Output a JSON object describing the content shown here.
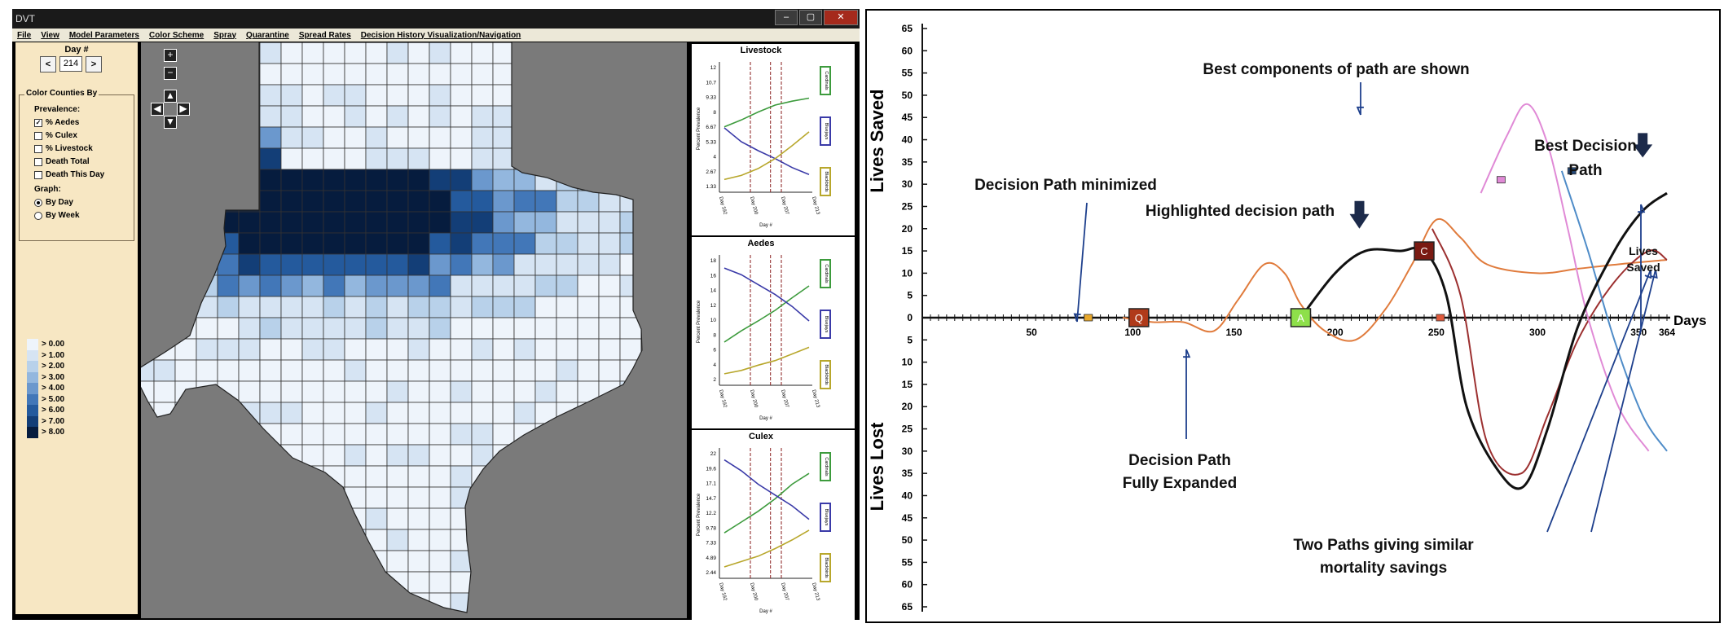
{
  "window": {
    "title": "DVT",
    "min": "–",
    "max": "▢",
    "close": "✕"
  },
  "menu": [
    "File",
    "View",
    "Model Parameters",
    "Color Scheme",
    "Spray",
    "Quarantine",
    "Spread Rates",
    "Decision History Visualization/Navigation"
  ],
  "sidebar": {
    "day_label": "Day #",
    "day_value": "214",
    "prev": "<",
    "next": ">",
    "group_title": "Color Counties By",
    "prevalence_label": "Prevalence:",
    "options": [
      {
        "label": "% Aedes",
        "checked": true
      },
      {
        "label": "% Culex",
        "checked": false
      },
      {
        "label": "% Livestock",
        "checked": false
      },
      {
        "label": "Death Total",
        "checked": false
      },
      {
        "label": "Death This Day",
        "checked": false
      }
    ],
    "graph_label": "Graph:",
    "graph_options": [
      {
        "label": "By Day",
        "selected": true
      },
      {
        "label": "By Week",
        "selected": false
      }
    ],
    "legend": [
      {
        "label": "> 0.00",
        "color": "#eef4fb"
      },
      {
        "label": "> 1.00",
        "color": "#d6e4f3"
      },
      {
        "label": "> 2.00",
        "color": "#b8d1ea"
      },
      {
        "label": "> 3.00",
        "color": "#93b7de"
      },
      {
        "label": "> 4.00",
        "color": "#6b98cd"
      },
      {
        "label": "> 5.00",
        "color": "#4277b8"
      },
      {
        "label": "> 6.00",
        "color": "#245a9d"
      },
      {
        "label": "> 7.00",
        "color": "#133e77"
      },
      {
        "label": "> 8.00",
        "color": "#061c3e"
      }
    ]
  },
  "map": {
    "zoom_in": "+",
    "zoom_out": "−",
    "pan": [
      "▲",
      "◀",
      "▶",
      "▼"
    ]
  },
  "mini_charts": [
    {
      "title": "Livestock",
      "y_ticks": [
        "12",
        "10.7",
        "9.33",
        "8",
        "6.67",
        "5.33",
        "4",
        "2.67",
        "1.33"
      ],
      "x_ticks": [
        "Day 192",
        "Day 200",
        "Day 207",
        "Day 213"
      ],
      "ylabel": "Percent Prevalence",
      "xlabel": "Day #",
      "legend": [
        "Cardinals",
        "Bluejays",
        "Blackbirds"
      ],
      "series": [
        {
          "color": "#3d9b3d",
          "values": [
            6.1,
            6.8,
            7.6,
            8.3,
            8.7,
            9.0
          ]
        },
        {
          "color": "#3a3aa8",
          "values": [
            6.0,
            4.6,
            3.7,
            2.9,
            2.0,
            1.3
          ]
        },
        {
          "color": "#b8a72c",
          "values": [
            0.8,
            1.2,
            1.9,
            2.9,
            4.2,
            5.6
          ]
        }
      ],
      "ylim": [
        0,
        12
      ]
    },
    {
      "title": "Aedes",
      "y_ticks": [
        "18",
        "16",
        "14",
        "12",
        "10",
        "8",
        "6",
        "4",
        "2"
      ],
      "x_ticks": [
        "Day 192",
        "Day 200",
        "Day 207",
        "Day 213"
      ],
      "ylabel": "Percent Prevalence",
      "xlabel": "Day #",
      "legend": [
        "Cardinals",
        "Bluejays",
        "Blackbirds"
      ],
      "series": [
        {
          "color": "#3d9b3d",
          "values": [
            5.8,
            7.5,
            9.0,
            10.6,
            12.5,
            14.3
          ]
        },
        {
          "color": "#3a3aa8",
          "values": [
            17.0,
            16.0,
            14.5,
            13.0,
            11.2,
            9.0
          ]
        },
        {
          "color": "#b8a72c",
          "values": [
            1.0,
            1.5,
            2.3,
            3.0,
            4.0,
            5.0
          ]
        }
      ],
      "ylim": [
        0,
        18
      ]
    },
    {
      "title": "Culex",
      "y_ticks": [
        "22",
        "19.6",
        "17.1",
        "14.7",
        "12.2",
        "9.78",
        "7.33",
        "4.89",
        "2.44"
      ],
      "x_ticks": [
        "Day 192",
        "Day 200",
        "Day 207",
        "Day 213"
      ],
      "ylabel": "Percent Prevalence",
      "xlabel": "Day #",
      "legend": [
        "Cardinals",
        "Bluejays",
        "Blackbirds"
      ],
      "series": [
        {
          "color": "#3d9b3d",
          "values": [
            7.5,
            9.5,
            11.5,
            13.8,
            16.5,
            18.5
          ]
        },
        {
          "color": "#3a3aa8",
          "values": [
            21.0,
            19.0,
            16.5,
            14.5,
            12.5,
            10.0
          ]
        },
        {
          "color": "#b8a72c",
          "values": [
            1.2,
            2.2,
            3.2,
            4.6,
            6.2,
            8.0
          ]
        }
      ],
      "ylim": [
        0,
        22
      ]
    }
  ],
  "decision_chart": {
    "y_labels": [
      "65",
      "60",
      "55",
      "50",
      "45",
      "40",
      "35",
      "30",
      "25",
      "20",
      "15",
      "10",
      "5",
      "0",
      "5",
      "10",
      "15",
      "20",
      "25",
      "30",
      "35",
      "40",
      "45",
      "50",
      "55",
      "60",
      "65"
    ],
    "x_labels": [
      "50",
      "100",
      "150",
      "200",
      "250",
      "300",
      "350",
      "364"
    ],
    "x_values": [
      50,
      100,
      150,
      200,
      250,
      300,
      350,
      364
    ],
    "xlim": [
      0,
      364
    ],
    "ylim": [
      -65,
      65
    ],
    "ylabel_top": "Lives Saved",
    "ylabel_bottom": "Lives Lost",
    "xlabel": "Days",
    "annotations": {
      "best_components": "Best components of path are shown",
      "best_decision_1": "Best Decision",
      "best_decision_2": "Path",
      "minimized": "Decision Path minimized",
      "highlighted": "Highlighted decision path",
      "lives_saved_1": "Lives",
      "lives_saved_2": "Saved",
      "expanded_1": "Decision Path",
      "expanded_2": "Fully Expanded",
      "two_paths_1": "Two Paths giving similar",
      "two_paths_2": "mortality savings"
    },
    "markers": [
      {
        "label": "Q",
        "x": 103,
        "y": 0,
        "color": "#b03a1a"
      },
      {
        "label": "A",
        "x": 183,
        "y": 0,
        "color": "#8ee04a"
      },
      {
        "label": "C",
        "x": 244,
        "y": 15,
        "color": "#7a1a12"
      }
    ],
    "colors": {
      "orange": "#e07b3c",
      "black": "#111111",
      "darkred": "#9c3030",
      "pink": "#e08ad6",
      "blue": "#4f8cc8"
    }
  }
}
